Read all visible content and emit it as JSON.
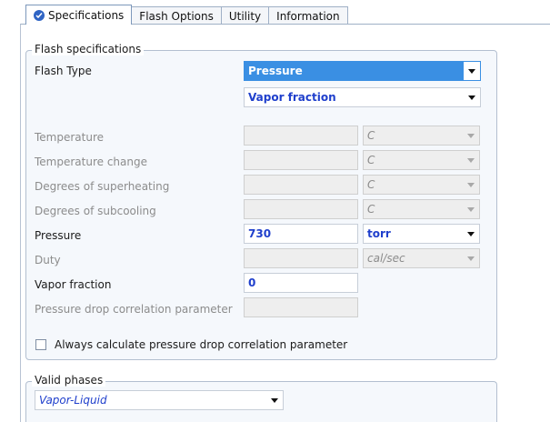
{
  "tabs": [
    {
      "label": "Specifications",
      "active": true,
      "icon": "check-circle-icon"
    },
    {
      "label": "Flash Options",
      "active": false
    },
    {
      "label": "Utility",
      "active": false
    },
    {
      "label": "Information",
      "active": false
    }
  ],
  "flash_specifications": {
    "group_title": "Flash specifications",
    "flash_type_label": "Flash Type",
    "flash_type_value": "Pressure",
    "second_spec_value": "Vapor fraction",
    "rows": [
      {
        "label": "Temperature",
        "value": "",
        "unit": "C",
        "enabled": false
      },
      {
        "label": "Temperature change",
        "value": "",
        "unit": "C",
        "enabled": false
      },
      {
        "label": "Degrees of superheating",
        "value": "",
        "unit": "C",
        "enabled": false
      },
      {
        "label": "Degrees of subcooling",
        "value": "",
        "unit": "C",
        "enabled": false
      },
      {
        "label": "Pressure",
        "value": "730",
        "unit": "torr",
        "enabled": true
      },
      {
        "label": "Duty",
        "value": "",
        "unit": "cal/sec",
        "enabled": false
      },
      {
        "label": "Vapor fraction",
        "value": "0",
        "unit": "",
        "enabled": true
      },
      {
        "label": "Pressure drop correlation parameter",
        "value": "",
        "unit": "",
        "enabled": false
      }
    ],
    "checkbox_label": "Always calculate pressure drop correlation parameter",
    "checkbox_checked": false
  },
  "valid_phases": {
    "group_title": "Valid phases",
    "value": "Vapor-Liquid"
  },
  "colors": {
    "accent": "#3a8fe3",
    "value_blue": "#1f3fcc",
    "disabled_text": "#8c8c8c"
  }
}
